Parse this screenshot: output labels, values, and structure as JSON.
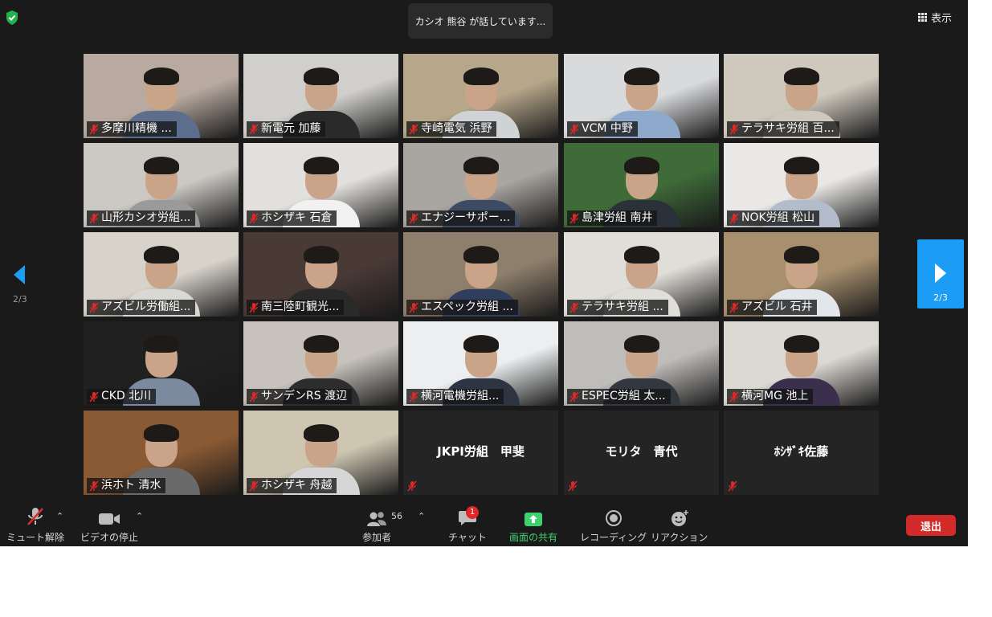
{
  "header": {
    "speaker_text": "カシオ 熊谷 が話しています...",
    "view_label": "表示"
  },
  "nav": {
    "page_indicator": "2/3"
  },
  "tiles": [
    {
      "name": "多摩川精機 ...",
      "bg": "#b8aaa0",
      "body": "#5d6e8c"
    },
    {
      "name": "新電元 加藤",
      "bg": "#d0cfcc",
      "body": "#2a2a2a"
    },
    {
      "name": "寺崎電気 浜野",
      "bg": "#b6a68a",
      "body": "#cfd3d6"
    },
    {
      "name": "VCM 中野",
      "bg": "#d9dadc",
      "body": "#8fa9cc"
    },
    {
      "name": "テラサキ労組 百...",
      "bg": "#cfc9bd",
      "body": "#cfc9bd"
    },
    {
      "name": "山形カシオ労組...",
      "bg": "#ccc9c4",
      "body": "#9a9a9a"
    },
    {
      "name": "ホシザキ 石倉",
      "bg": "#e2e0dc",
      "body": "#f1f1f1"
    },
    {
      "name": "エナジーサポー...",
      "bg": "#a9a5a0",
      "body": "#3c4a63"
    },
    {
      "name": "島津労組 南井",
      "bg": "#3f6b39",
      "body": "#2a3138"
    },
    {
      "name": "NOK労組 松山",
      "bg": "#e9e8e6",
      "body": "#b3bccb"
    },
    {
      "name": "アズビル労働組...",
      "bg": "#d7d3cb",
      "body": "#d9d8d4"
    },
    {
      "name": "南三陸町観光...",
      "bg": "#4a3a36",
      "body": "#2a2a2a"
    },
    {
      "name": "エスペック労組 ...",
      "bg": "#8e7f6c",
      "body": "#2f3e5c"
    },
    {
      "name": "テラサキ労組 ...",
      "bg": "#e0ded8",
      "body": "#e0ded8"
    },
    {
      "name": "アズビル 石井",
      "bg": "#a8906e",
      "body": "#e3e6ea"
    },
    {
      "name": "CKD 北川",
      "bg": "#202020",
      "body": "#7c8aa0"
    },
    {
      "name": "サンデンRS 渡辺",
      "bg": "#c7c3bc",
      "body": "#2d2d2d"
    },
    {
      "name": "横河電機労組...",
      "bg": "#eceeef",
      "body": "#2d3442"
    },
    {
      "name": "ESPEC労組 太...",
      "bg": "#bfbdba",
      "body": "#333740"
    },
    {
      "name": "横河MG 池上",
      "bg": "#dcd9d3",
      "body": "#3a2f4d"
    },
    {
      "name": "浜ホト 清水",
      "bg": "#8a5a34",
      "body": "#6a6a6a"
    },
    {
      "name": "ホシザキ 舟越",
      "bg": "#cfc6b2",
      "body": "#d6d6d6"
    }
  ],
  "name_only_tiles": [
    {
      "name": "JKPI労組　甲斐"
    },
    {
      "name": "モリタ　青代"
    },
    {
      "name": "ﾎｼｻﾞｷ佐藤"
    }
  ],
  "toolbar": {
    "unmute_label": "ミュート解除",
    "video_label": "ビデオの停止",
    "participants_label": "参加者",
    "participants_count": "56",
    "chat_label": "チャット",
    "chat_badge": "1",
    "share_label": "画面の共有",
    "record_label": "レコーディング",
    "reaction_label": "リアクション",
    "leave_label": "退出"
  },
  "colors": {
    "background": "#1a1a1a",
    "next_button": "#1b9cf5",
    "share_green": "#3ed26c",
    "leave_red": "#d32a2a",
    "mute_red": "#e02828"
  },
  "icons": [
    "shield-icon",
    "grid-icon",
    "mic-muted-icon",
    "video-icon",
    "participants-icon",
    "chat-icon",
    "share-screen-icon",
    "record-icon",
    "reaction-icon",
    "chevron-left-icon",
    "chevron-right-icon"
  ]
}
